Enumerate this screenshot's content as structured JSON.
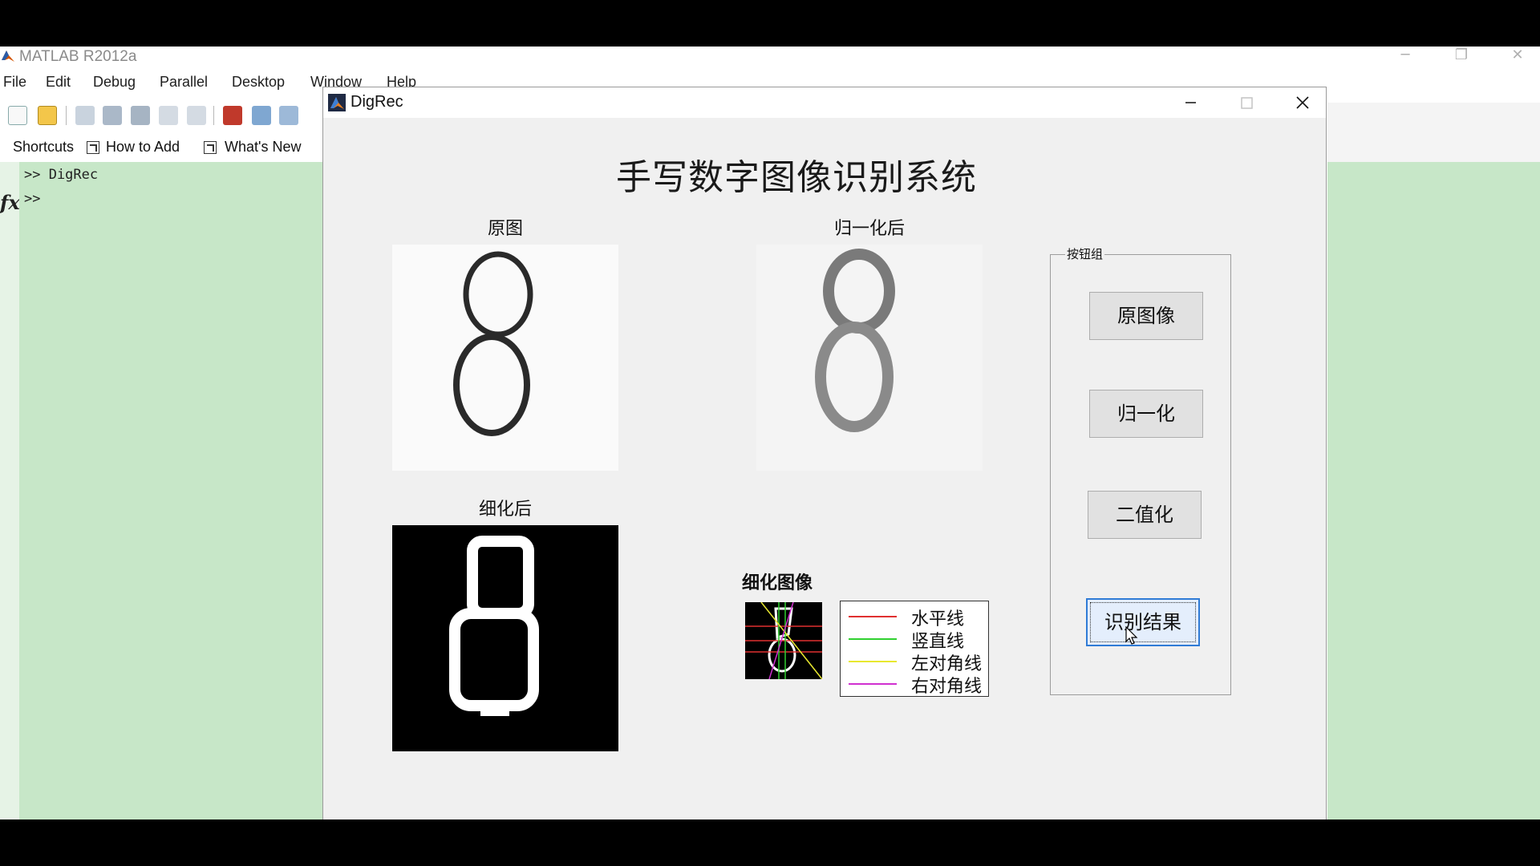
{
  "matlab": {
    "title": "MATLAB  R2012a",
    "menu": [
      "File",
      "Edit",
      "Debug",
      "Parallel",
      "Desktop",
      "Window",
      "Help"
    ],
    "shortcuts": [
      "Shortcuts",
      "How to Add",
      "What's New"
    ],
    "command_lines": [
      ">> DigRec",
      ">>"
    ],
    "fx_label": "fx"
  },
  "figure": {
    "title": "DigRec",
    "heading": "手写数字图像识别系统",
    "panels": {
      "original": "原图",
      "normalized": "归一化后",
      "thinned": "细化后",
      "thin_image": "细化图像"
    },
    "button_group": {
      "title": "按钮组",
      "buttons": [
        "原图像",
        "归一化",
        "二值化",
        "识别结果"
      ],
      "active": "识别结果"
    },
    "legend": [
      {
        "label": "水平线",
        "color": "#e03030"
      },
      {
        "label": "竖直线",
        "color": "#30d030"
      },
      {
        "label": "左对角线",
        "color": "#e8e830"
      },
      {
        "label": "右对角线",
        "color": "#d030d0"
      }
    ]
  }
}
